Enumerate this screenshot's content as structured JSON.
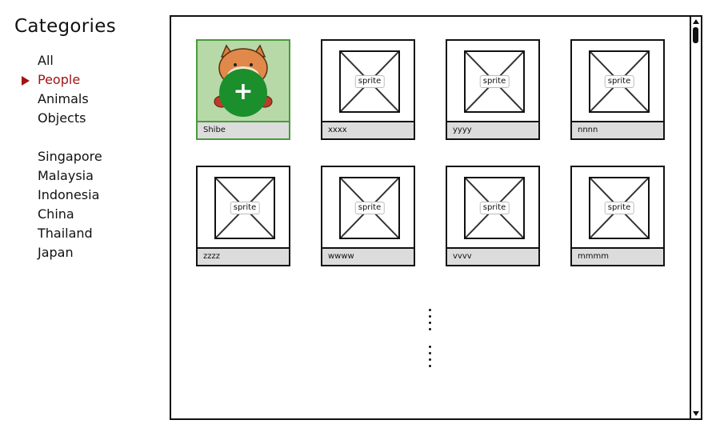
{
  "sidebar": {
    "title": "Categories",
    "groups": [
      [
        "All",
        "People",
        "Animals",
        "Objects"
      ],
      [
        "Singapore",
        "Malaysia",
        "Indonesia",
        "China",
        "Thailand",
        "Japan"
      ]
    ],
    "selected": "People"
  },
  "tiles": [
    {
      "label": "Shibe",
      "selected": true,
      "add_icon": "plus-icon",
      "add_symbol": "+"
    },
    {
      "label": "xxxx",
      "placeholder": "sprite"
    },
    {
      "label": "yyyy",
      "placeholder": "sprite"
    },
    {
      "label": "nnnn",
      "placeholder": "sprite"
    },
    {
      "label": "zzzz",
      "placeholder": "sprite"
    },
    {
      "label": "wwww",
      "placeholder": "sprite"
    },
    {
      "label": "vvvv",
      "placeholder": "sprite"
    },
    {
      "label": "mmmm",
      "placeholder": "sprite"
    }
  ],
  "colors": {
    "selected_category": "#a01414",
    "selected_tile_bg": "#b7d9a8",
    "selected_tile_border": "#4a9a3e",
    "add_button": "#1a8f2b",
    "label_bg": "#dcdcdc"
  }
}
